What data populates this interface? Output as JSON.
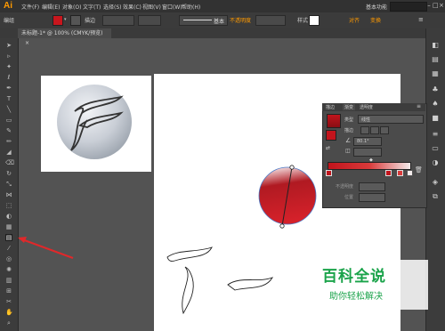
{
  "app": {
    "logo": "Ai"
  },
  "menu": [
    "文件(F)",
    "编辑(E)",
    "对象(O)",
    "文字(T)",
    "选择(S)",
    "效果(C)",
    "视图(V)",
    "窗口(W)",
    "帮助(H)"
  ],
  "workspace": "基本功能",
  "window_buttons": [
    "–",
    "□",
    "×"
  ],
  "control_bar": {
    "group_label": "编组",
    "stroke_label": "描边",
    "stroke_style": "基本",
    "opacity_label": "不透明度",
    "style_label": "样式",
    "align_label": "对齐",
    "transform_label": "变换",
    "fill_color": "#c8161d"
  },
  "document_tab": {
    "title": "未标题-1* @ 100% (CMYK/预览)",
    "close": "×"
  },
  "gradient_panel": {
    "tabs": [
      "描边",
      "渐变",
      "透明度"
    ],
    "type_label": "类型",
    "type_value": "线性",
    "stroke_label": "描边",
    "angle_value": "80.1°",
    "opacity_label": "不透明度",
    "location_label": "位置",
    "colors": {
      "start": "#c2141c",
      "end": "#f4ecec"
    }
  },
  "watermark": {
    "title": "百科全说",
    "subtitle": "助你轻松解决"
  },
  "colors": {
    "accent": "#ff9a00",
    "arrow": "#e0282a",
    "brand_green": "#1aa34a"
  }
}
